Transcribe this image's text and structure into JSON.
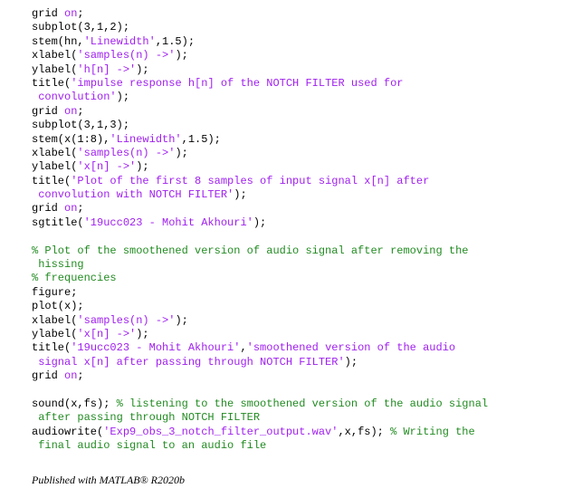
{
  "colors": {
    "string": "#a020f0",
    "comment": "#228b22",
    "code": "#000000",
    "background": "#ffffff"
  },
  "code_lines": [
    [
      [
        "grid ",
        "plain"
      ],
      [
        "on",
        "str"
      ],
      [
        ";",
        "plain"
      ]
    ],
    [
      [
        "subplot(3,1,2);",
        "plain"
      ]
    ],
    [
      [
        "stem(hn,",
        "plain"
      ],
      [
        "'Linewidth'",
        "str"
      ],
      [
        ",1.5);",
        "plain"
      ]
    ],
    [
      [
        "xlabel(",
        "plain"
      ],
      [
        "'samples(n) ->'",
        "str"
      ],
      [
        ");",
        "plain"
      ]
    ],
    [
      [
        "ylabel(",
        "plain"
      ],
      [
        "'h[n] ->'",
        "str"
      ],
      [
        ");",
        "plain"
      ]
    ],
    [
      [
        "title(",
        "plain"
      ],
      [
        "'impulse response h[n] of the NOTCH FILTER used for",
        "str"
      ]
    ],
    [
      [
        " convolution'",
        "str"
      ],
      [
        ");",
        "plain"
      ]
    ],
    [
      [
        "grid ",
        "plain"
      ],
      [
        "on",
        "str"
      ],
      [
        ";",
        "plain"
      ]
    ],
    [
      [
        "subplot(3,1,3);",
        "plain"
      ]
    ],
    [
      [
        "stem(x(1:8),",
        "plain"
      ],
      [
        "'Linewidth'",
        "str"
      ],
      [
        ",1.5);",
        "plain"
      ]
    ],
    [
      [
        "xlabel(",
        "plain"
      ],
      [
        "'samples(n) ->'",
        "str"
      ],
      [
        ");",
        "plain"
      ]
    ],
    [
      [
        "ylabel(",
        "plain"
      ],
      [
        "'x[n] ->'",
        "str"
      ],
      [
        ");",
        "plain"
      ]
    ],
    [
      [
        "title(",
        "plain"
      ],
      [
        "'Plot of the first 8 samples of input signal x[n] after",
        "str"
      ]
    ],
    [
      [
        " convolution with NOTCH FILTER'",
        "str"
      ],
      [
        ");",
        "plain"
      ]
    ],
    [
      [
        "grid ",
        "plain"
      ],
      [
        "on",
        "str"
      ],
      [
        ";",
        "plain"
      ]
    ],
    [
      [
        "sgtitle(",
        "plain"
      ],
      [
        "'19ucc023 - Mohit Akhouri'",
        "str"
      ],
      [
        ");",
        "plain"
      ]
    ],
    [],
    [
      [
        "% Plot of the smoothened version of audio signal after removing the",
        "cmt"
      ]
    ],
    [
      [
        " hissing",
        "cmt"
      ]
    ],
    [
      [
        "% frequencies",
        "cmt"
      ]
    ],
    [
      [
        "figure;",
        "plain"
      ]
    ],
    [
      [
        "plot(x);",
        "plain"
      ]
    ],
    [
      [
        "xlabel(",
        "plain"
      ],
      [
        "'samples(n) ->'",
        "str"
      ],
      [
        ");",
        "plain"
      ]
    ],
    [
      [
        "ylabel(",
        "plain"
      ],
      [
        "'x[n] ->'",
        "str"
      ],
      [
        ");",
        "plain"
      ]
    ],
    [
      [
        "title(",
        "plain"
      ],
      [
        "'19ucc023 - Mohit Akhouri'",
        "str"
      ],
      [
        ",",
        "plain"
      ],
      [
        "'smoothened version of the audio",
        "str"
      ]
    ],
    [
      [
        " signal x[n] after passing through NOTCH FILTER'",
        "str"
      ],
      [
        ");",
        "plain"
      ]
    ],
    [
      [
        "grid ",
        "plain"
      ],
      [
        "on",
        "str"
      ],
      [
        ";",
        "plain"
      ]
    ],
    [],
    [
      [
        "sound(x,fs); ",
        "plain"
      ],
      [
        "% listening to the smoothened version of the audio signal",
        "cmt"
      ]
    ],
    [
      [
        " after passing through NOTCH FILTER",
        "cmt"
      ]
    ],
    [
      [
        "audiowrite(",
        "plain"
      ],
      [
        "'Exp9_obs_3_notch_filter_output.wav'",
        "str"
      ],
      [
        ",x,fs); ",
        "plain"
      ],
      [
        "% Writing the",
        "cmt"
      ]
    ],
    [
      [
        " final audio signal to an audio file",
        "cmt"
      ]
    ]
  ],
  "footer": {
    "text": "Published with MATLAB® R2020b"
  }
}
